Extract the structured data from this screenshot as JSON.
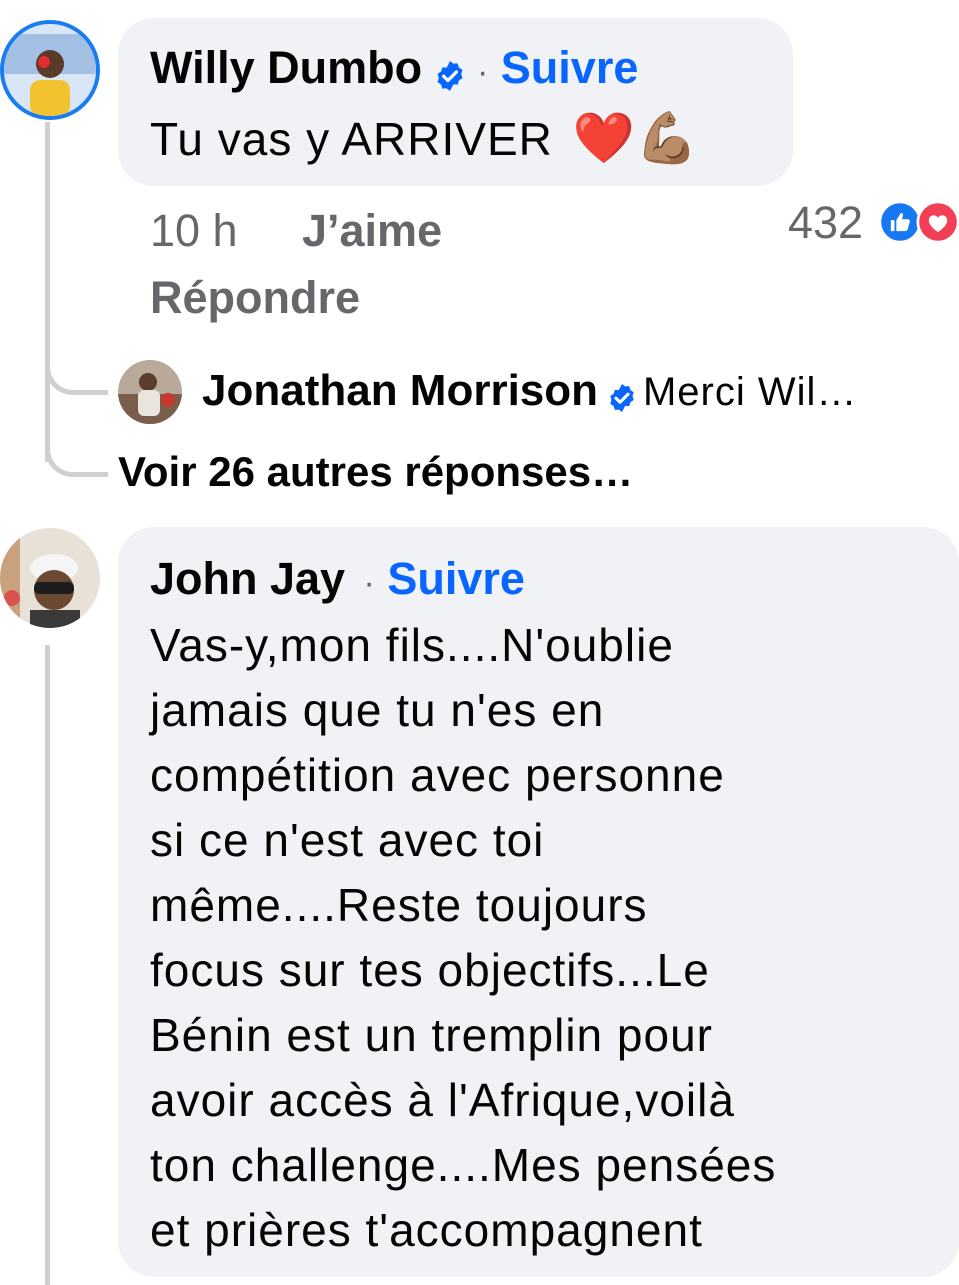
{
  "comment1": {
    "author": "Willy Dumbo",
    "follow": "Suivre",
    "separator": "·",
    "text": "Tu vas y ARRIVER",
    "emojis": "❤️💪🏽",
    "time": "10 h",
    "like": "J’aime",
    "reply": "Répondre",
    "reaction_count": "432",
    "reaction_icons": [
      "like-icon",
      "love-icon"
    ],
    "avatar_icon": "avatar-willy-dumbo"
  },
  "reply1": {
    "author": "Jonathan Morrison",
    "preview": "Merci Wil…",
    "avatar_icon": "avatar-jonathan-morrison"
  },
  "more_replies": "Voir 26 autres réponses…",
  "comment2": {
    "author": "John Jay",
    "separator": "·",
    "follow": "Suivre",
    "lines": [
      "Vas-y,mon fils....N'oublie",
      "jamais que tu n'es en",
      "compétition avec personne",
      "si ce n'est avec toi",
      "même....Reste toujours",
      "focus sur tes objectifs...Le",
      "Bénin est un tremplin pour",
      "avoir accès à l'Afrique,voilà",
      "ton challenge....Mes pensées",
      "et prières t'accompagnent"
    ],
    "avatar_icon": "avatar-john-jay"
  },
  "colors": {
    "accent": "#0866ff",
    "bubble": "#f0f2f5",
    "muted": "#65676b",
    "thread": "#ced0d4",
    "love": "#f33e58"
  }
}
